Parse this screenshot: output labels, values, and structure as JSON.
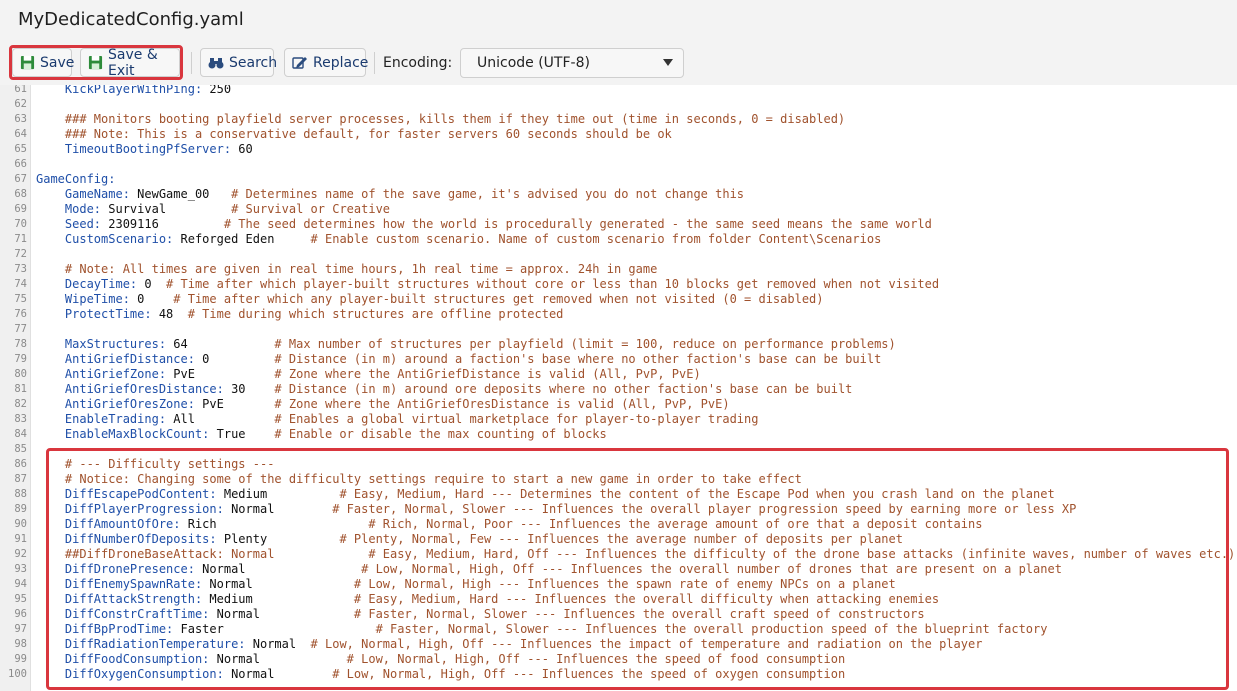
{
  "window": {
    "title": "MyDedicatedConfig.yaml"
  },
  "toolbar": {
    "save_label": "Save",
    "save_exit_label": "Save & Exit",
    "search_label": "Search",
    "replace_label": "Replace",
    "encoding_label": "Encoding:",
    "encoding_value": "Unicode (UTF-8)"
  },
  "colors": {
    "highlight": "#d9363e",
    "key": "#1f4fa8",
    "comment": "#a0522d",
    "value": "#111111"
  },
  "lines": [
    {
      "n": "61",
      "key": "    KickPlayerWithPing:",
      "val": " 250",
      "comment": ""
    },
    {
      "n": "62",
      "key": "",
      "val": "",
      "comment": ""
    },
    {
      "n": "63",
      "key": "",
      "val": "",
      "comment": "    ### Monitors booting playfield server processes, kills them if they time out (time in seconds, 0 = disabled)"
    },
    {
      "n": "64",
      "key": "",
      "val": "",
      "comment": "    ### Note: This is a conservative default, for faster servers 60 seconds should be ok"
    },
    {
      "n": "65",
      "key": "    TimeoutBootingPfServer:",
      "val": " 60",
      "comment": ""
    },
    {
      "n": "66",
      "key": "",
      "val": "",
      "comment": ""
    },
    {
      "n": "67",
      "key": "GameConfig:",
      "val": "",
      "comment": ""
    },
    {
      "n": "68",
      "key": "    GameName:",
      "val": " NewGame_00",
      "comment": "   # Determines name of the save game, it's advised you do not change this"
    },
    {
      "n": "69",
      "key": "    Mode:",
      "val": " Survival",
      "comment": "         # Survival or Creative"
    },
    {
      "n": "70",
      "key": "    Seed:",
      "val": " 2309116",
      "comment": "         # The seed determines how the world is procedurally generated - the same seed means the same world"
    },
    {
      "n": "71",
      "key": "    CustomScenario:",
      "val": " Reforged Eden",
      "comment": "     # Enable custom scenario. Name of custom scenario from folder Content\\Scenarios"
    },
    {
      "n": "72",
      "key": "",
      "val": "",
      "comment": ""
    },
    {
      "n": "73",
      "key": "",
      "val": "",
      "comment": "    # Note: All times are given in real time hours, 1h real time = approx. 24h in game"
    },
    {
      "n": "74",
      "key": "    DecayTime:",
      "val": " 0",
      "comment": "  # Time after which player-built structures without core or less than 10 blocks get removed when not visited"
    },
    {
      "n": "75",
      "key": "    WipeTime:",
      "val": " 0",
      "comment": "    # Time after which any player-built structures get removed when not visited (0 = disabled)"
    },
    {
      "n": "76",
      "key": "    ProtectTime:",
      "val": " 48",
      "comment": "  # Time during which structures are offline protected"
    },
    {
      "n": "77",
      "key": "",
      "val": "",
      "comment": ""
    },
    {
      "n": "78",
      "key": "    MaxStructures:",
      "val": " 64",
      "comment": "            # Max number of structures per playfield (limit = 100, reduce on performance problems)"
    },
    {
      "n": "79",
      "key": "    AntiGriefDistance:",
      "val": " 0",
      "comment": "         # Distance (in m) around a faction's base where no other faction's base can be built"
    },
    {
      "n": "80",
      "key": "    AntiGriefZone:",
      "val": " PvE",
      "comment": "           # Zone where the AntiGriefDistance is valid (All, PvP, PvE)"
    },
    {
      "n": "81",
      "key": "    AntiGriefOresDistance:",
      "val": " 30",
      "comment": "    # Distance (in m) around ore deposits where no other faction's base can be built"
    },
    {
      "n": "82",
      "key": "    AntiGriefOresZone:",
      "val": " PvE",
      "comment": "       # Zone where the AntiGriefOresDistance is valid (All, PvP, PvE)"
    },
    {
      "n": "83",
      "key": "    EnableTrading:",
      "val": " All",
      "comment": "           # Enables a global virtual marketplace for player-to-player trading"
    },
    {
      "n": "84",
      "key": "    EnableMaxBlockCount:",
      "val": " True",
      "comment": "    # Enable or disable the max counting of blocks"
    },
    {
      "n": "85",
      "key": "",
      "val": "",
      "comment": ""
    },
    {
      "n": "86",
      "key": "",
      "val": "",
      "comment": "    # --- Difficulty settings ---"
    },
    {
      "n": "87",
      "key": "",
      "val": "",
      "comment": "    # Notice: Changing some of the difficulty settings require to start a new game in order to take effect"
    },
    {
      "n": "88",
      "key": "    DiffEscapePodContent:",
      "val": " Medium",
      "comment": "          # Easy, Medium, Hard --- Determines the content of the Escape Pod when you crash land on the planet"
    },
    {
      "n": "89",
      "key": "    DiffPlayerProgression:",
      "val": " Normal",
      "comment": "        # Faster, Normal, Slower --- Influences the overall player progression speed by earning more or less XP"
    },
    {
      "n": "90",
      "key": "    DiffAmountOfOre:",
      "val": " Rich",
      "comment": "                     # Rich, Normal, Poor --- Influences the average amount of ore that a deposit contains"
    },
    {
      "n": "91",
      "key": "    DiffNumberOfDeposits:",
      "val": " Plenty",
      "comment": "          # Plenty, Normal, Few --- Influences the average number of deposits per planet"
    },
    {
      "n": "92",
      "key": "",
      "val": "",
      "comment": "    ##DiffDroneBaseAttack: Normal             # Easy, Medium, Hard, Off --- Influences the difficulty of the drone base attacks (infinite waves, number of waves etc.)"
    },
    {
      "n": "93",
      "key": "    DiffDronePresence:",
      "val": " Normal",
      "comment": "                # Low, Normal, High, Off --- Influences the overall number of drones that are present on a planet"
    },
    {
      "n": "94",
      "key": "    DiffEnemySpawnRate:",
      "val": " Normal",
      "comment": "              # Low, Normal, High --- Influences the spawn rate of enemy NPCs on a planet"
    },
    {
      "n": "95",
      "key": "    DiffAttackStrength:",
      "val": " Medium",
      "comment": "              # Easy, Medium, Hard --- Influences the overall difficulty when attacking enemies"
    },
    {
      "n": "96",
      "key": "    DiffConstrCraftTime:",
      "val": " Normal",
      "comment": "             # Faster, Normal, Slower --- Influences the overall craft speed of constructors"
    },
    {
      "n": "97",
      "key": "    DiffBpProdTime:",
      "val": " Faster",
      "comment": "                     # Faster, Normal, Slower --- Influences the overall production speed of the blueprint factory"
    },
    {
      "n": "98",
      "key": "    DiffRadiationTemperature:",
      "val": " Normal",
      "comment": "  # Low, Normal, High, Off --- Influences the impact of temperature and radiation on the player"
    },
    {
      "n": "99",
      "key": "    DiffFoodConsumption:",
      "val": " Normal",
      "comment": "            # Low, Normal, High, Off --- Influences the speed of food consumption"
    },
    {
      "n": "100",
      "key": "    DiffOxygenConsumption:",
      "val": " Normal",
      "comment": "        # Low, Normal, High, Off --- Influences the speed of oxygen consumption"
    }
  ]
}
